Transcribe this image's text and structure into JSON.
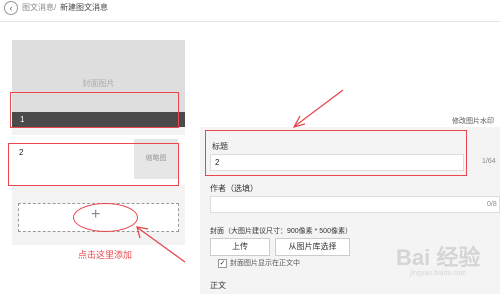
{
  "breadcrumb": {
    "back_icon": "chevron-left-icon",
    "parent": "图文消息",
    "separator": "/",
    "current": "新建图文消息"
  },
  "article_list": {
    "cover_placeholder": "封面图片",
    "items": [
      {
        "label": "1"
      },
      {
        "label": "2",
        "thumb_label": "缩略图"
      }
    ],
    "add_icon": "plus-icon",
    "hint": "点击这里添加"
  },
  "editor": {
    "watermark_link": "修改图片水印",
    "title_label": "标题",
    "title_value": "2",
    "title_count": "1/64",
    "author_label": "作者（选填）",
    "author_value": "",
    "author_count": "0/8",
    "cover_label": "封面（大图片建议尺寸：900像素 * 500像素）",
    "upload_button": "上传",
    "library_button": "从图片库选择",
    "show_cover_checkbox": {
      "checked": true,
      "label": "封面图片显示在正文中"
    },
    "body_label": "正文"
  },
  "watermark_logo": {
    "text": "Bai 经验",
    "sub": "jingyan.baidu.com"
  },
  "colors": {
    "annotation_red": "#e8474c",
    "selected_bar": "#4a4a4a"
  }
}
